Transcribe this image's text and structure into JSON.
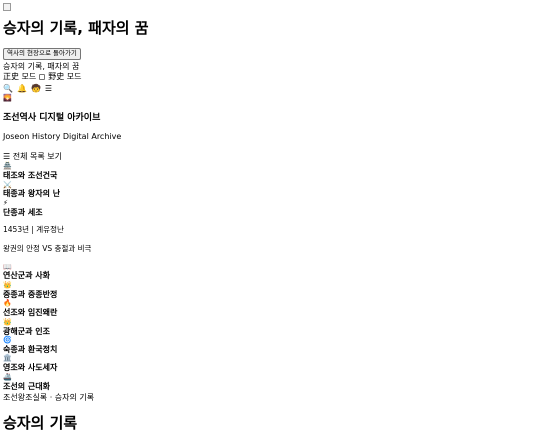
{
  "page": {
    "title": "승자의 기록, 패자의 꿈",
    "back_button": "역사의 현장으로 돌아가기",
    "subtitle_text": "승자의 기록, 패자의 꿈",
    "mode_correct": "正史 모드",
    "mode_unofficial": "野史 모드"
  },
  "toolbar": {
    "icons": [
      "🔍",
      "🔔",
      "🧒",
      "☰"
    ]
  },
  "sidebar": {
    "logo_icon": "🌄",
    "archive_title": "조선역사 디지털 아카이브",
    "archive_subtitle": "Joseon History Digital Archive",
    "toc_label": "☰ 전체 목록 보기",
    "items": [
      {
        "icon": "🏯",
        "label": "태조와 조선건국"
      },
      {
        "icon": "⚔️",
        "label": "태종과 왕자의 난"
      },
      {
        "icon": "⚡",
        "label": "단종과 세조"
      }
    ],
    "detail_line1": "1453년 | 계유정난",
    "detail_line2": "왕권의 안정 VS 충절과 비극",
    "items2": [
      {
        "icon": "📖",
        "label": "연산군과 사화"
      },
      {
        "icon": "👑",
        "label": "중종과 중종반정"
      },
      {
        "icon": "🔥",
        "label": "선조와 임진왜란"
      },
      {
        "icon": "👑",
        "label": "광해군과 인조"
      },
      {
        "icon": "🌀",
        "label": "숙종과 환국정치"
      },
      {
        "icon": "🏛️",
        "label": "영조와 사도세자"
      },
      {
        "icon": "🚢",
        "label": "조선의 근대화"
      }
    ],
    "footer": "조선왕조실록 · 승자의 기록"
  },
  "main": {
    "heading": "승자의 기록"
  }
}
